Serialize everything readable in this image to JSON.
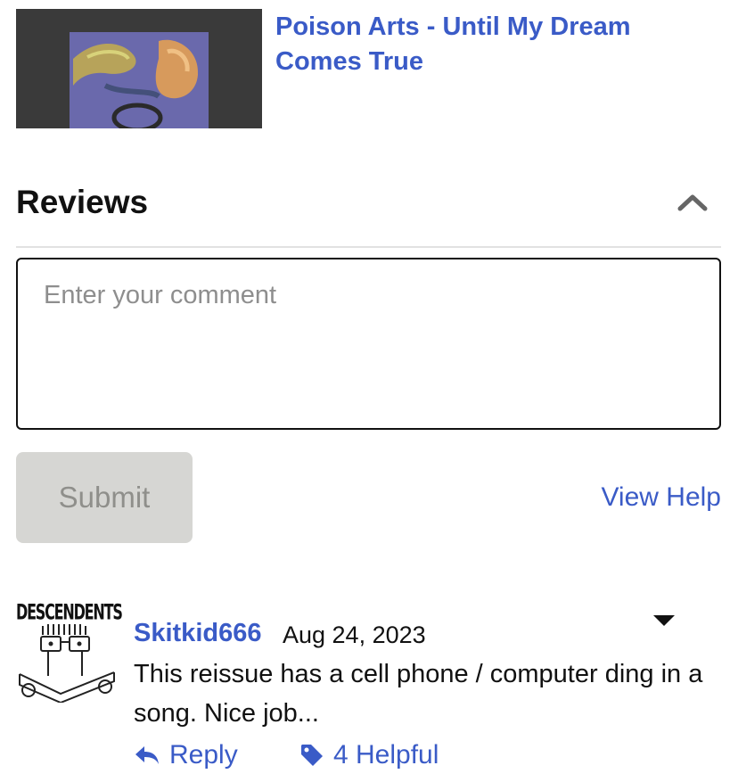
{
  "release": {
    "title": "Poison Arts - Until My Dream Comes True",
    "cover_icon": "album-cover-image"
  },
  "reviews": {
    "heading": "Reviews",
    "collapse_icon": "chevron-up-icon",
    "comment_placeholder": "Enter your comment",
    "comment_value": "",
    "submit_label": "Submit",
    "view_help_label": "View Help"
  },
  "review_items": [
    {
      "avatar_band_text": "DESCENDENTS",
      "avatar_icon": "user-avatar-image",
      "username": "Skitkid666",
      "date": "Aug 24, 2023",
      "text": "This reissue has a cell phone / computer ding in a song. Nice job...",
      "more_icon": "caret-down-icon",
      "reply_label": "Reply",
      "reply_icon": "reply-arrow-icon",
      "helpful_label": "4 Helpful",
      "helpful_icon": "tag-icon"
    }
  ],
  "colors": {
    "link": "#3a5bc7",
    "submit_bg": "#d6d6d3",
    "submit_text": "#8f8f8b",
    "divider": "#e2e2e2"
  }
}
